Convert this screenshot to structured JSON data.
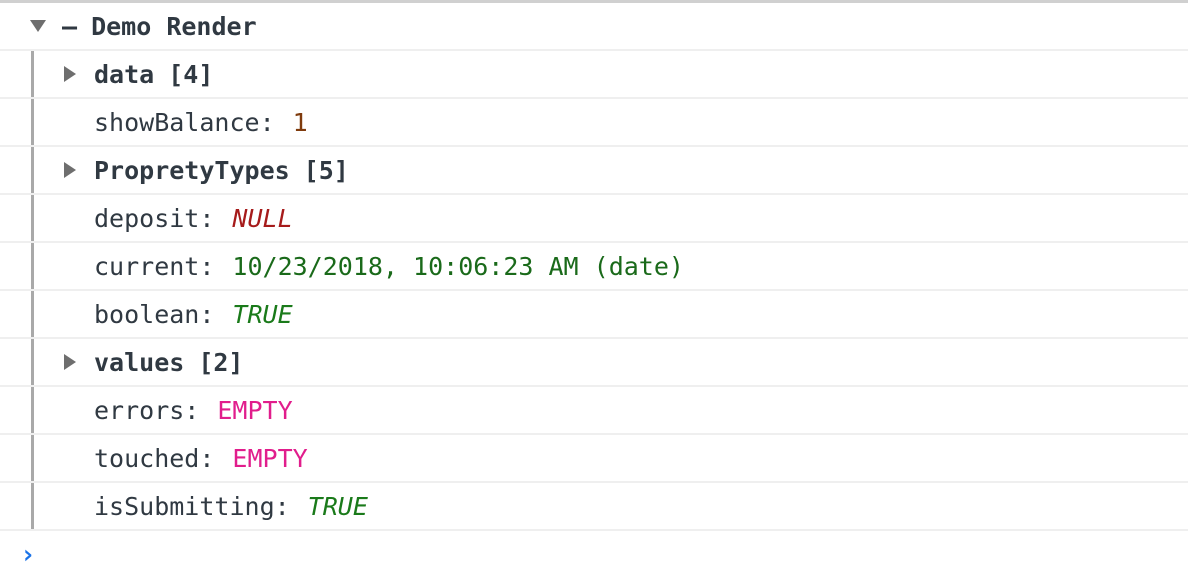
{
  "group": {
    "title": "Demo Render",
    "collapse_marker": "–"
  },
  "rows": [
    {
      "type": "expandable",
      "key": "data",
      "count": "[4]"
    },
    {
      "type": "pair",
      "key": "showBalance:",
      "value": "1",
      "kind": "number"
    },
    {
      "type": "expandable",
      "key": "PropretyTypes",
      "count": "[5]"
    },
    {
      "type": "pair",
      "key": "deposit:",
      "value": "NULL",
      "kind": "null"
    },
    {
      "type": "pair",
      "key": "current:",
      "value": "10/23/2018, 10:06:23 AM (date)",
      "kind": "date"
    },
    {
      "type": "pair",
      "key": "boolean:",
      "value": "TRUE",
      "kind": "true"
    },
    {
      "type": "expandable",
      "key": "values",
      "count": "[2]"
    },
    {
      "type": "pair",
      "key": "errors:",
      "value": "EMPTY",
      "kind": "empty"
    },
    {
      "type": "pair",
      "key": "touched:",
      "value": "EMPTY",
      "kind": "empty"
    },
    {
      "type": "pair",
      "key": "isSubmitting:",
      "value": "TRUE",
      "kind": "true"
    }
  ],
  "prompt": {
    "glyph": "›"
  },
  "colors": {
    "number": "#7f3b0d",
    "null": "#a61b1b",
    "date": "#1a6a1a",
    "true": "#1a7a1a",
    "empty": "#e11d8c",
    "prompt": "#1a73e8"
  }
}
